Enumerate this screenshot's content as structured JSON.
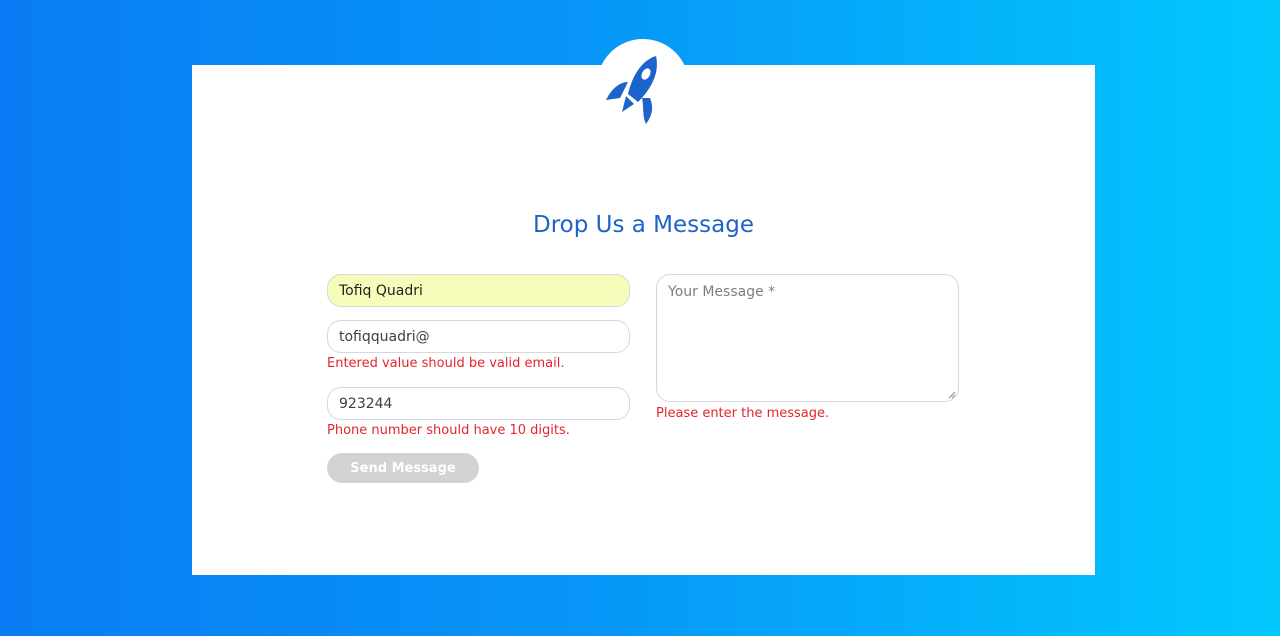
{
  "header": {
    "title": "Drop Us a Message"
  },
  "form": {
    "name_value": "Tofiq Quadri",
    "email_value": "tofiqquadri@",
    "email_error": "Entered value should be valid email.",
    "phone_value": "923244",
    "phone_error": "Phone number should have 10 digits.",
    "message_placeholder": "Your Message *",
    "message_error": "Please enter the message.",
    "submit_label": "Send Message"
  },
  "logo": {
    "icon": "rocket-icon",
    "color": "#1c63cb"
  },
  "colors": {
    "accent": "#1c63cb",
    "error": "#e3262d",
    "autofill_bg": "#f8fcbb",
    "disabled_button": "#d3d3d3"
  }
}
